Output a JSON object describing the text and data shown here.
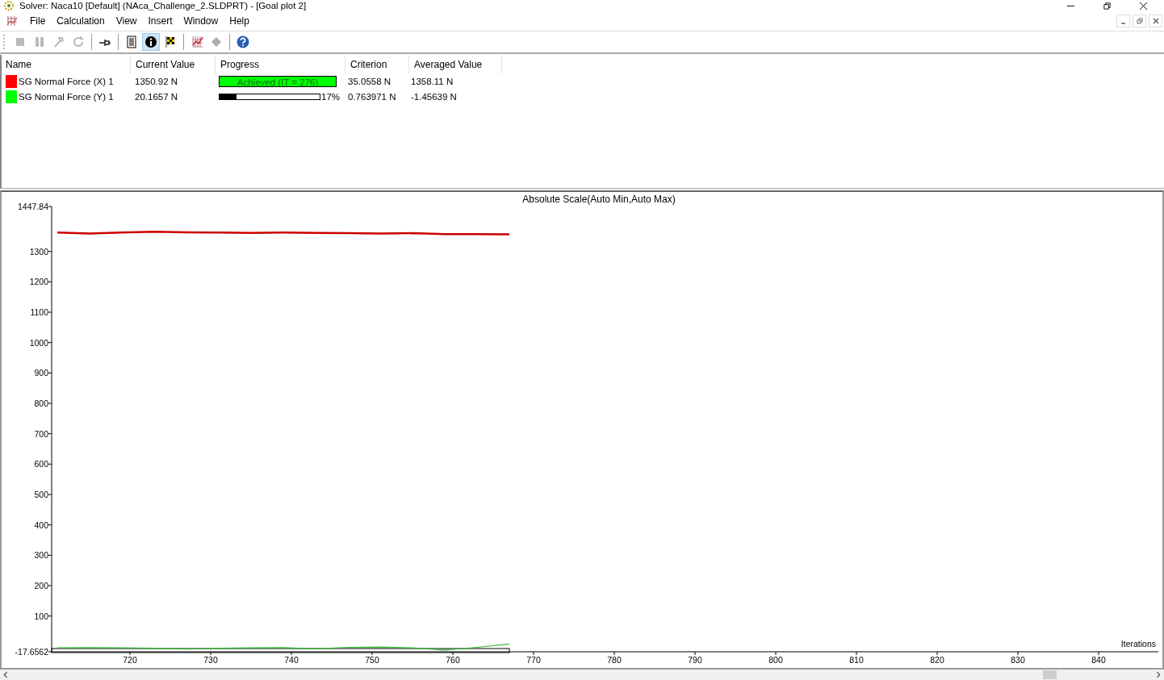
{
  "window": {
    "title": "Solver: Naca10 [Default] (NAca_Challenge_2.SLDPRT) - [Goal plot 2]"
  },
  "menu": [
    "File",
    "Calculation",
    "View",
    "Insert",
    "Window",
    "Help"
  ],
  "toolbar": [
    {
      "disabled": true,
      "selected": false
    },
    {
      "disabled": true,
      "selected": false
    },
    {
      "disabled": true,
      "selected": false
    },
    {
      "disabled": true,
      "selected": false
    },
    {
      "disabled": false,
      "selected": false
    },
    {
      "disabled": false,
      "selected": false
    },
    {
      "disabled": false,
      "selected": true
    },
    {
      "disabled": false,
      "selected": false
    },
    {
      "disabled": false,
      "selected": false
    },
    {
      "disabled": true,
      "selected": false
    },
    {
      "disabled": false,
      "selected": false
    }
  ],
  "table": {
    "columns": [
      "Name",
      "Current Value",
      "Progress",
      "Criterion",
      "Averaged Value"
    ],
    "rows": [
      {
        "color": "#ff0000",
        "name": "SG Normal Force (X) 1",
        "current": "1350.92 N",
        "progress": {
          "kind": "achieved",
          "label": "Achieved (IT = 276)"
        },
        "criterion": "35.0558 N",
        "averaged": "1358.11 N"
      },
      {
        "color": "#00ff00",
        "name": "SG Normal Force (Y) 1",
        "current": "20.1657 N",
        "progress": {
          "kind": "bar",
          "level": 0.17,
          "reading": "17%"
        },
        "criterion": "0.763971 N",
        "averaged": "-1.45639 N"
      }
    ]
  },
  "plot": {
    "chart_data": {
      "type": "line",
      "title": "Absolute Scale(Auto Min,Auto Max)",
      "xlabel": "Iterations",
      "x": [
        711,
        715,
        719,
        723,
        727,
        731,
        735,
        739,
        743,
        747,
        751,
        755,
        759,
        763,
        767
      ],
      "series": [
        {
          "color": "#cc0000",
          "values": [
            1362,
            1359,
            1362,
            1365,
            1363,
            1362,
            1361,
            1362,
            1361,
            1360,
            1359,
            1360,
            1357,
            1357,
            1356
          ]
        },
        {
          "color": "#33bb33",
          "values": [
            -5,
            -4,
            -5,
            -6,
            -9,
            -6,
            -5,
            -4,
            -8,
            -3,
            -2,
            -5,
            -12,
            -3,
            8
          ]
        }
      ],
      "xlim": [
        710.3,
        847.4
      ],
      "ylim": [
        -17.6562,
        1447.84
      ],
      "xticks": [
        720,
        730,
        740,
        750,
        760,
        770,
        780,
        790,
        800,
        810,
        820,
        830,
        840
      ],
      "yticks": [
        {
          "value": -17.6562,
          "label": "-17.6562"
        },
        100,
        200,
        300,
        400,
        500,
        600,
        700,
        800,
        900,
        1000,
        1100,
        1200,
        1300,
        {
          "value": 1447.84,
          "label": "1447.84"
        }
      ]
    }
  }
}
